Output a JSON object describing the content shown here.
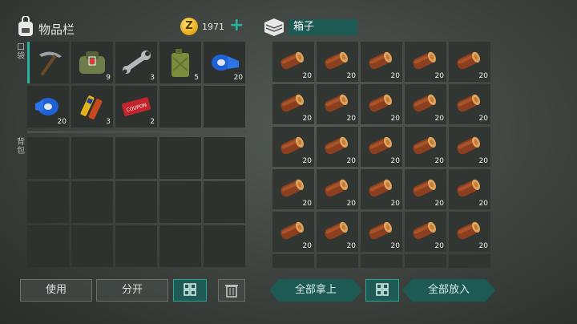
{
  "inventory": {
    "title": "物品栏",
    "coins": "1971",
    "coin_symbol": "Z",
    "add_label": "+",
    "hand_label": "口袋",
    "bag_label": "背包",
    "hotbar": [
      {
        "icon": "pickaxe-icon",
        "count": ""
      },
      {
        "icon": "first-aid-bag-icon",
        "count": "9"
      },
      {
        "icon": "wrench-icon",
        "count": "3"
      },
      {
        "icon": "jerrycan-icon",
        "count": "5"
      },
      {
        "icon": "duct-tape-icon",
        "count": "20"
      },
      {
        "icon": "duct-tape-icon",
        "count": "20"
      },
      {
        "icon": "batteries-icon",
        "count": "3"
      },
      {
        "icon": "coupon-icon",
        "count": "2"
      }
    ],
    "coupon_text": "COUPON",
    "buttons": {
      "use": "使用",
      "split": "分开"
    }
  },
  "chest": {
    "title": "箱子",
    "item_icon": "wood-log-icon",
    "count": "20",
    "buttons": {
      "take_all": "全部拿上",
      "put_all": "全部放入"
    }
  },
  "colors": {
    "accent": "#2ab3a3",
    "slot": "#2d322f",
    "wood": "#a0522d"
  }
}
